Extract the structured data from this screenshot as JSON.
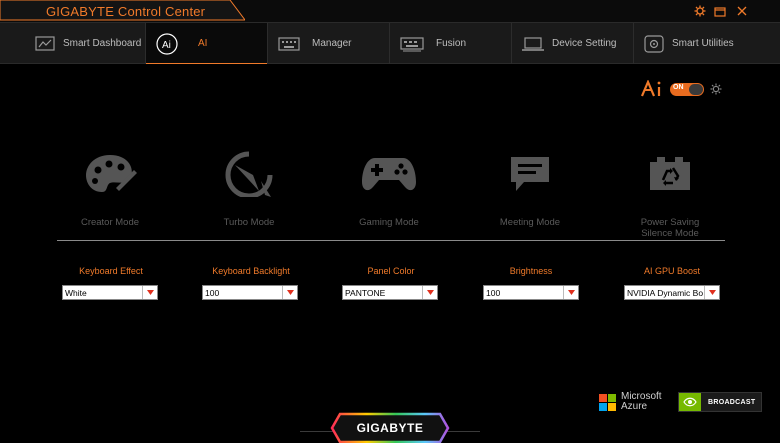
{
  "app": {
    "title": "GIGABYTE Control Center"
  },
  "colors": {
    "accent": "#f07a2a",
    "background": "#000000",
    "tabbar": "#1a1a1a"
  },
  "tabs": [
    {
      "label": "Smart Dashboard",
      "icon": "dashboard-icon",
      "active": false
    },
    {
      "label": "AI",
      "icon": "ai-icon",
      "active": true
    },
    {
      "label": "Manager",
      "icon": "keyboard-icon",
      "active": false
    },
    {
      "label": "Fusion",
      "icon": "rgb-keyboard-icon",
      "active": false
    },
    {
      "label": "Device Setting",
      "icon": "laptop-icon",
      "active": false
    },
    {
      "label": "Smart Utilities",
      "icon": "utilities-icon",
      "active": false
    }
  ],
  "ai_switch": {
    "logo": "Ai",
    "state_text": "ON",
    "enabled": true
  },
  "modes": [
    {
      "label": "Creator Mode",
      "icon": "palette-icon"
    },
    {
      "label": "Turbo Mode",
      "icon": "speedometer-icon"
    },
    {
      "label": "Gaming Mode",
      "icon": "gamepad-icon"
    },
    {
      "label": "Meeting Mode",
      "icon": "chat-icon"
    },
    {
      "label": "Power Saving\nSilence Mode",
      "icon": "battery-recycle-icon"
    }
  ],
  "settings": [
    {
      "label": "Keyboard Effect",
      "value": "White"
    },
    {
      "label": "Keyboard Backlight",
      "value": "100"
    },
    {
      "label": "Panel Color",
      "value": "PANTONE"
    },
    {
      "label": "Brightness",
      "value": "100"
    },
    {
      "label": "AI GPU Boost",
      "value": "NVIDIA Dynamic Boost"
    }
  ],
  "partners": {
    "microsoft_line1": "Microsoft",
    "microsoft_line2": "Azure",
    "nvidia": "BROADCAST"
  },
  "footer": {
    "brand": "GIGABYTE"
  }
}
